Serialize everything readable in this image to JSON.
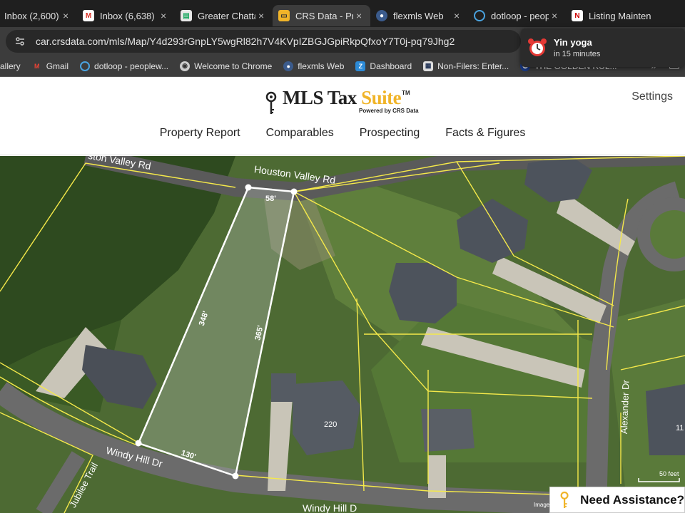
{
  "browser": {
    "tabs": [
      {
        "label": "Inbox (2,600)",
        "icon": "gmail-icon",
        "active": false
      },
      {
        "label": "Inbox (6,638)",
        "icon": "gmail-icon",
        "active": false
      },
      {
        "label": "Greater Chatta",
        "icon": "site-icon",
        "active": false
      },
      {
        "label": "CRS Data - Pro",
        "icon": "folder-icon",
        "active": true
      },
      {
        "label": "flexmls Web",
        "icon": "flexmls-icon",
        "active": false
      },
      {
        "label": "dotloop - peop",
        "icon": "dotloop-icon",
        "active": false
      },
      {
        "label": "Listing Mainten",
        "icon": "n-icon",
        "active": false
      }
    ],
    "url": "car.crsdata.com/mls/Map/Y4d293rGnpLY5wgRl82h7V4KVpIZBGJGpiRkpQfxoY7T0j-pq79Jhg2",
    "bookmarks": [
      {
        "label": "allery",
        "icon": ""
      },
      {
        "label": "Gmail",
        "icon": "gmail-icon"
      },
      {
        "label": "dotloop - peoplew...",
        "icon": "dotloop-icon"
      },
      {
        "label": "Welcome to Chrome",
        "icon": "chrome-icon"
      },
      {
        "label": "flexmls Web",
        "icon": "flexmls-icon"
      },
      {
        "label": "Dashboard",
        "icon": "z-icon"
      },
      {
        "label": "Non-Filers: Enter...",
        "icon": "irs-icon"
      },
      {
        "label": "THE GOLDEN RUL...",
        "icon": "globe-icon"
      }
    ],
    "more": "»"
  },
  "notification": {
    "title": "Yin yoga",
    "subtitle": "in 15 minutes"
  },
  "site": {
    "logo_main": "MLS Tax ",
    "logo_accent": "Suite",
    "logo_tm": "TM",
    "logo_sub": "Powered by CRS Data",
    "settings": "Settings",
    "nav": [
      "Property Report",
      "Comparables",
      "Prospecting",
      "Facts & Figures"
    ]
  },
  "map": {
    "roads": {
      "houston_partial": "ston Valley Rd",
      "houston": "Houston Valley Rd",
      "windy": "Windy Hill Dr",
      "windy_bottom": "Windy Hill D",
      "jubilee": "Jubilee Trail",
      "alexander": "Alexander Dr"
    },
    "dimensions": {
      "top": "58'",
      "left": "348'",
      "right": "365'",
      "bottom": "130'"
    },
    "house_numbers": {
      "main": "220",
      "right": "11"
    },
    "scale_label": "50 feet",
    "attribution": "Imagery"
  },
  "assistance": {
    "label": "Need Assistance?"
  },
  "colors": {
    "parcel_lines": "#f5e94a",
    "selected_parcel": "#ffffff",
    "accent_gold": "#f0b429",
    "browser_dark": "#1f1f1f"
  }
}
